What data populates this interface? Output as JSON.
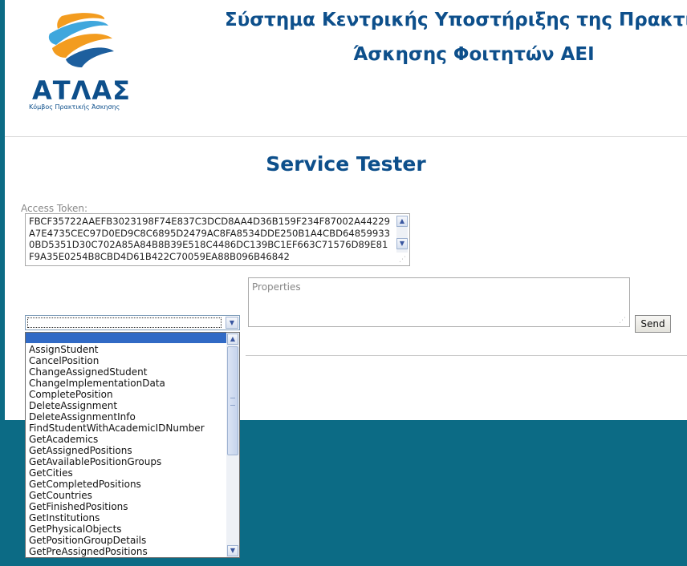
{
  "header": {
    "logo_word": "ΑΤΛΑΣ",
    "logo_subtitle": "Κόμβος Πρακτικής Άσκησης",
    "title_line1": "Σύστημα Κεντρικής Υποστήριξης της Πρακτι",
    "title_line2": "Άσκησης Φοιτητών ΑΕΙ"
  },
  "main": {
    "heading": "Service Tester",
    "token_label": "Access Token:",
    "token_value": "FBCF35722AAEFB3023198F74E837C3DCD8AA4D36B159F234F87002A44229A7E4735CEC97D0ED9C8C6895D2479AC8FA8534DDE250B1A4CBD648599330BD5351D30C702A85A84B8B39E518C4486DC139BC1EF663C71576D89E81F9A35E0254B8CBD4D61B422C70059EA88B096B46842",
    "properties_placeholder": "Properties",
    "send_label": "Send",
    "selected_method": ""
  },
  "methods": [
    "AssignStudent",
    "CancelPosition",
    "ChangeAssignedStudent",
    "ChangeImplementationData",
    "CompletePosition",
    "DeleteAssignment",
    "DeleteAssignmentInfo",
    "FindStudentWithAcademicIDNumber",
    "GetAcademics",
    "GetAssignedPositions",
    "GetAvailablePositionGroups",
    "GetCities",
    "GetCompletedPositions",
    "GetCountries",
    "GetFinishedPositions",
    "GetInstitutions",
    "GetPhysicalObjects",
    "GetPositionGroupDetails",
    "GetPreAssignedPositions"
  ],
  "colors": {
    "brand_blue": "#0d4f8b",
    "teal_background": "#0c6b85",
    "logo_orange": "#f39c1f",
    "logo_light_blue": "#3fa7dd",
    "selection_blue": "#316ac5"
  }
}
